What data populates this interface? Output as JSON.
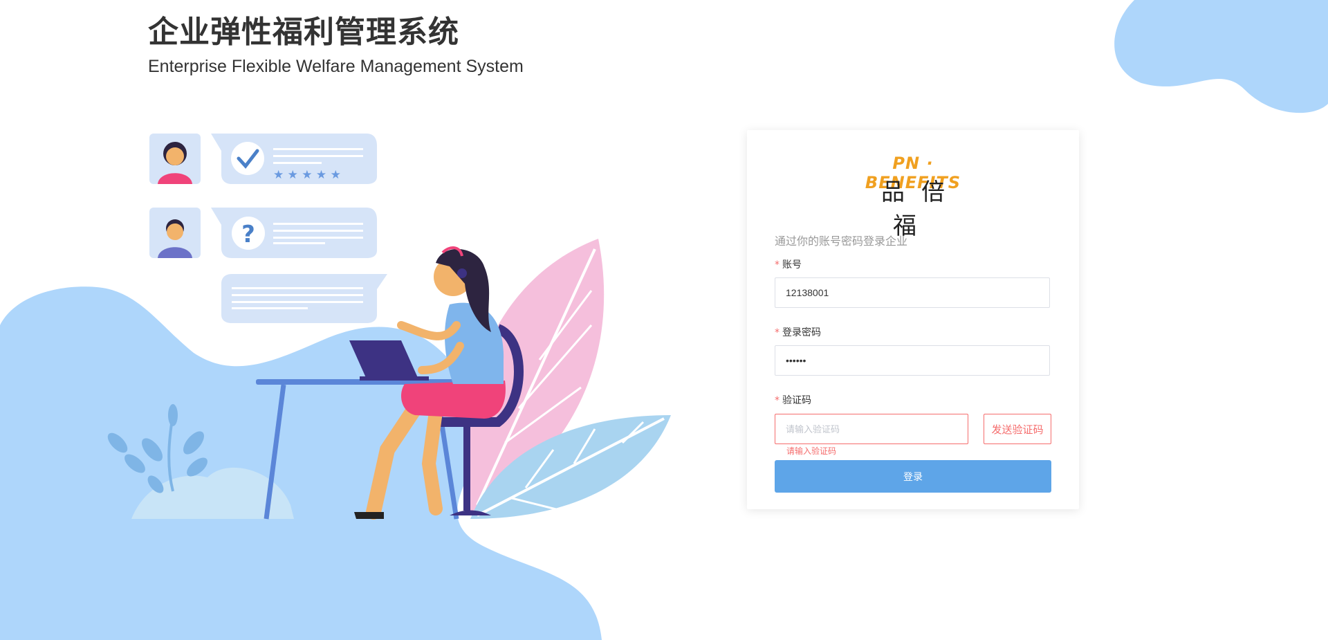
{
  "header": {
    "title_cn": "企业弹性福利管理系统",
    "title_en": "Enterprise Flexible Welfare Management System"
  },
  "logo": {
    "text_en": "PN · BENEFITS",
    "text_cn": "品倍福"
  },
  "login": {
    "subtitle": "通过你的账号密码登录企业",
    "required_mark": "*",
    "account_label": "账号",
    "account_value": "12138001",
    "password_label": "登录密码",
    "password_value": "••••••",
    "code_label": "验证码",
    "code_placeholder": "请输入验证码",
    "send_code_label": "发送验证码",
    "code_error": "请输入验证码",
    "submit_label": "登录"
  },
  "colors": {
    "accent_blue": "#5ea5e8",
    "background_blob": "#aed6fb",
    "error_red": "#f56c6c",
    "logo_orange": "#f0a020"
  }
}
